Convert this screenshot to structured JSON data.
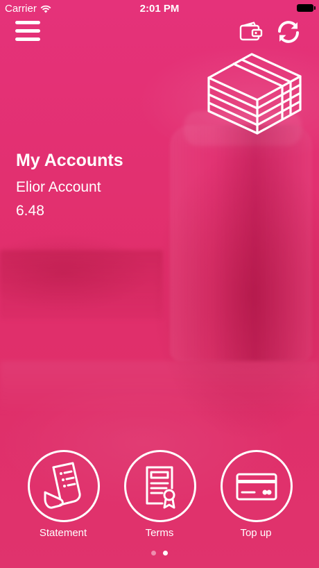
{
  "status_bar": {
    "carrier": "Carrier",
    "time": "2:01 PM"
  },
  "header": {
    "menu_icon": "hamburger-menu-icon",
    "wallet_icon": "wallet-icon",
    "refresh_icon": "refresh-icon",
    "illustration_icon": "money-stack-icon"
  },
  "account": {
    "title": "My Accounts",
    "name": "Elior Account",
    "balance": "6.48"
  },
  "actions": [
    {
      "label": "Statement",
      "icon": "receipt-icon"
    },
    {
      "label": "Terms",
      "icon": "certificate-document-icon"
    },
    {
      "label": "Top up",
      "icon": "credit-card-icon"
    }
  ],
  "pager": {
    "page_count": 2,
    "active_page": 2
  },
  "colors": {
    "background": "#e2306c",
    "foreground": "#ffffff"
  }
}
